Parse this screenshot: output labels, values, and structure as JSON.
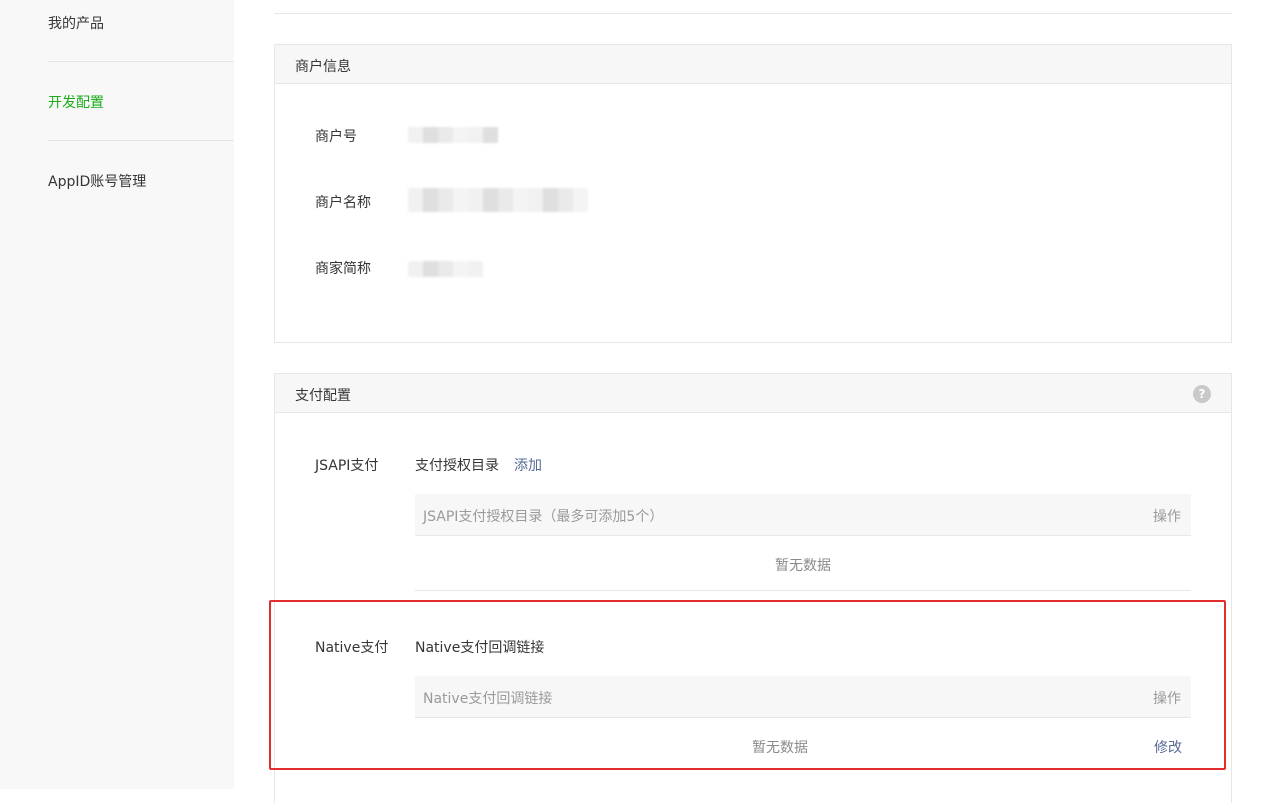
{
  "sidebar": {
    "items": [
      {
        "label": "我的产品",
        "active": false
      },
      {
        "label": "开发配置",
        "active": true
      },
      {
        "label": "AppID账号管理",
        "active": false
      }
    ]
  },
  "merchant_panel": {
    "title": "商户信息",
    "fields": [
      {
        "label": "商户号"
      },
      {
        "label": "商户名称"
      },
      {
        "label": "商家简称"
      }
    ]
  },
  "pay_panel": {
    "title": "支付配置",
    "help_icon": "?",
    "jsapi": {
      "label": "JSAPI支付",
      "sub_label": "支付授权目录",
      "add_link": "添加",
      "table_header": "JSAPI支付授权目录（最多可添加5个）",
      "table_action": "操作",
      "empty_text": "暂无数据"
    },
    "native": {
      "label": "Native支付",
      "sub_label": "Native支付回调链接",
      "table_header": "Native支付回调链接",
      "table_action": "操作",
      "empty_text": "暂无数据",
      "edit_link": "修改"
    }
  },
  "colors": {
    "accent": "#1aad19",
    "link": "#576b95",
    "highlight_border": "#e12d2d"
  }
}
